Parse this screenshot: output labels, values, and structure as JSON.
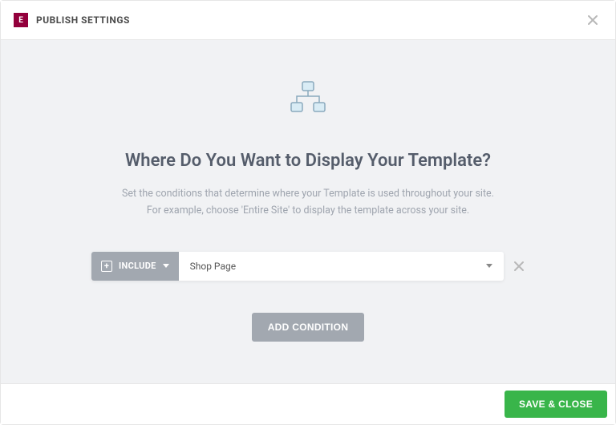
{
  "header": {
    "title": "PUBLISH SETTINGS",
    "logo_letter": "E"
  },
  "content": {
    "heading": "Where Do You Want to Display Your Template?",
    "description": "Set the conditions that determine where your Template is used throughout your site.\nFor example, choose 'Entire Site' to display the template across your site."
  },
  "condition": {
    "mode_label": "INCLUDE",
    "selected_value": "Shop Page"
  },
  "buttons": {
    "add_condition": "ADD CONDITION",
    "save_close": "SAVE & CLOSE"
  }
}
